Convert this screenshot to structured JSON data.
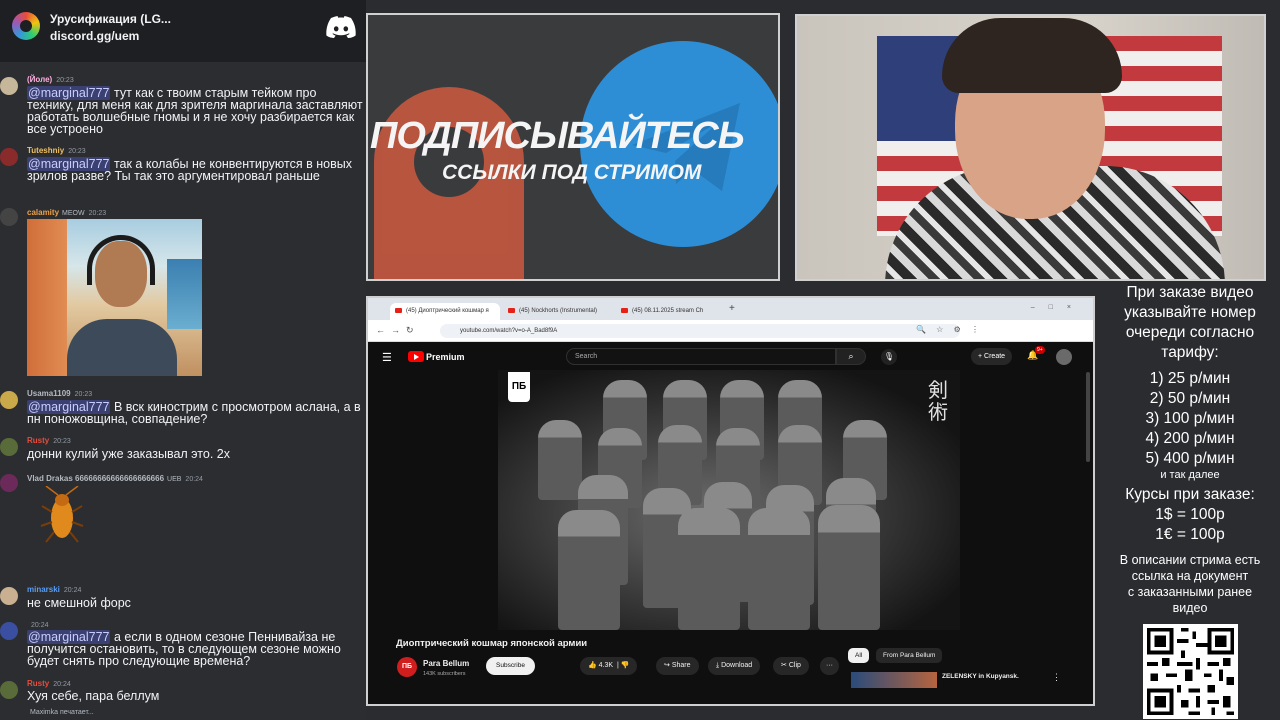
{
  "discord": {
    "server_name": "Урусификация (LG...",
    "invite": "discord.gg/uem",
    "typing": "Maximka печатает...",
    "messages": [
      {
        "author": "(Йоле)",
        "author_color": "#ffb0e0",
        "time": "20:23",
        "badge": "",
        "parts": [
          {
            "mention": "@marginal777"
          },
          {
            "text": " тут как с твоим старым тейком про технику, для меня как для зрителя маргинала заставляют работать волшебные гномы и я не хочу разбирается как все устроено"
          }
        ]
      },
      {
        "author": "Tuteshniy",
        "author_color": "#f0c060",
        "time": "20:23",
        "badge": "",
        "parts": [
          {
            "mention": "@marginal777"
          },
          {
            "text": " так а колабы не конвентируются в новых зрилов разве? Ты так это аргументировал раньше"
          }
        ]
      },
      {
        "author": "calamity",
        "author_color": "#f0a040",
        "time": "20:23",
        "badge": "MEOW",
        "parts": []
      },
      {
        "author": "Usama1109",
        "author_color": "#b5bac1",
        "time": "20:23",
        "badge": "",
        "parts": [
          {
            "mention": "@marginal777"
          },
          {
            "text": " В вск кинострим с просмотром аслана, а в пн поножовщина, совпадение?"
          }
        ]
      },
      {
        "author": "Rusty",
        "author_color": "#e74c3c",
        "time": "20:23",
        "badge": "",
        "parts": [
          {
            "text": "донни кулий уже заказывал это. 2х"
          }
        ]
      },
      {
        "author": "Vlad Drakas 66666666666666666666",
        "author_color": "#b5bac1",
        "time": "20:24",
        "badge": "UEB",
        "parts": []
      },
      {
        "author": "minarski",
        "author_color": "#5a9cf0",
        "time": "20:24",
        "badge": "",
        "parts": [
          {
            "text": "не смешной форс"
          }
        ]
      },
      {
        "author": "",
        "author_color": "#b5bac1",
        "time": "20:24",
        "badge": "",
        "parts": [
          {
            "mention": "@marginal777"
          },
          {
            "text": " а если в одном сезоне Пеннивайза не получится остановить, то в следующем сезоне можно будет снять про следующие времена?"
          }
        ]
      },
      {
        "author": "Rusty",
        "author_color": "#e74c3c",
        "time": "20:24",
        "badge": "",
        "parts": [
          {
            "text": "Хуя себе, пара беллум"
          }
        ]
      }
    ]
  },
  "promo": {
    "title": "ПОДПИСЫВАЙТЕСЬ",
    "subtitle": "ССЫЛКИ ПОД СТРИМОМ"
  },
  "pricing": {
    "intro": [
      "При заказе видео",
      "указывайте номер",
      "очереди согласно",
      "тарифу:"
    ],
    "tiers": [
      "1) 25 р/мин",
      "2) 50 р/мин",
      "3) 100 р/мин",
      "4) 200 р/мин",
      "5) 400 р/мин"
    ],
    "etc": "и так далее",
    "rates_title": "Курсы при заказе:",
    "rates": [
      "1$ = 100р",
      "1€ = 100р"
    ],
    "note": [
      "В описании стрима есть",
      "ссылка на документ",
      "с заказанными ранее",
      "видео"
    ]
  },
  "browser": {
    "tabs": [
      "(45) Диоптрический кошмар я",
      "(45) Nockhorts (Instrumental)",
      "(45) 08.11.2025 stream Ch"
    ],
    "url": "youtube.com/watch?v=o-A_Bad8f9A",
    "new_tab": "+"
  },
  "youtube": {
    "brand": "Premium",
    "search_placeholder": "Search",
    "create_label": "Create",
    "notifications": "9+",
    "video_title": "Диоптрический кошмар японской армии",
    "channel_name": "Para Bellum",
    "channel_subs": "143K subscribers",
    "channel_logo_text": "ПБ",
    "subscribe": "Subscribe",
    "likes": "4.3K",
    "share": "Share",
    "download": "Download",
    "clip": "Clip",
    "more": "···",
    "chip_all": "All",
    "chip_from": "From Para Bellum",
    "rec_title": "ZELENSKY in Kupyansk.",
    "calligraphy": "剣術"
  },
  "colors": {
    "discord_bg": "#2b2d31",
    "mention_bg": "#3c4270",
    "promo_red": "#c5583f",
    "promo_blue": "#2d8ed6",
    "yt_red": "#ff0000"
  }
}
